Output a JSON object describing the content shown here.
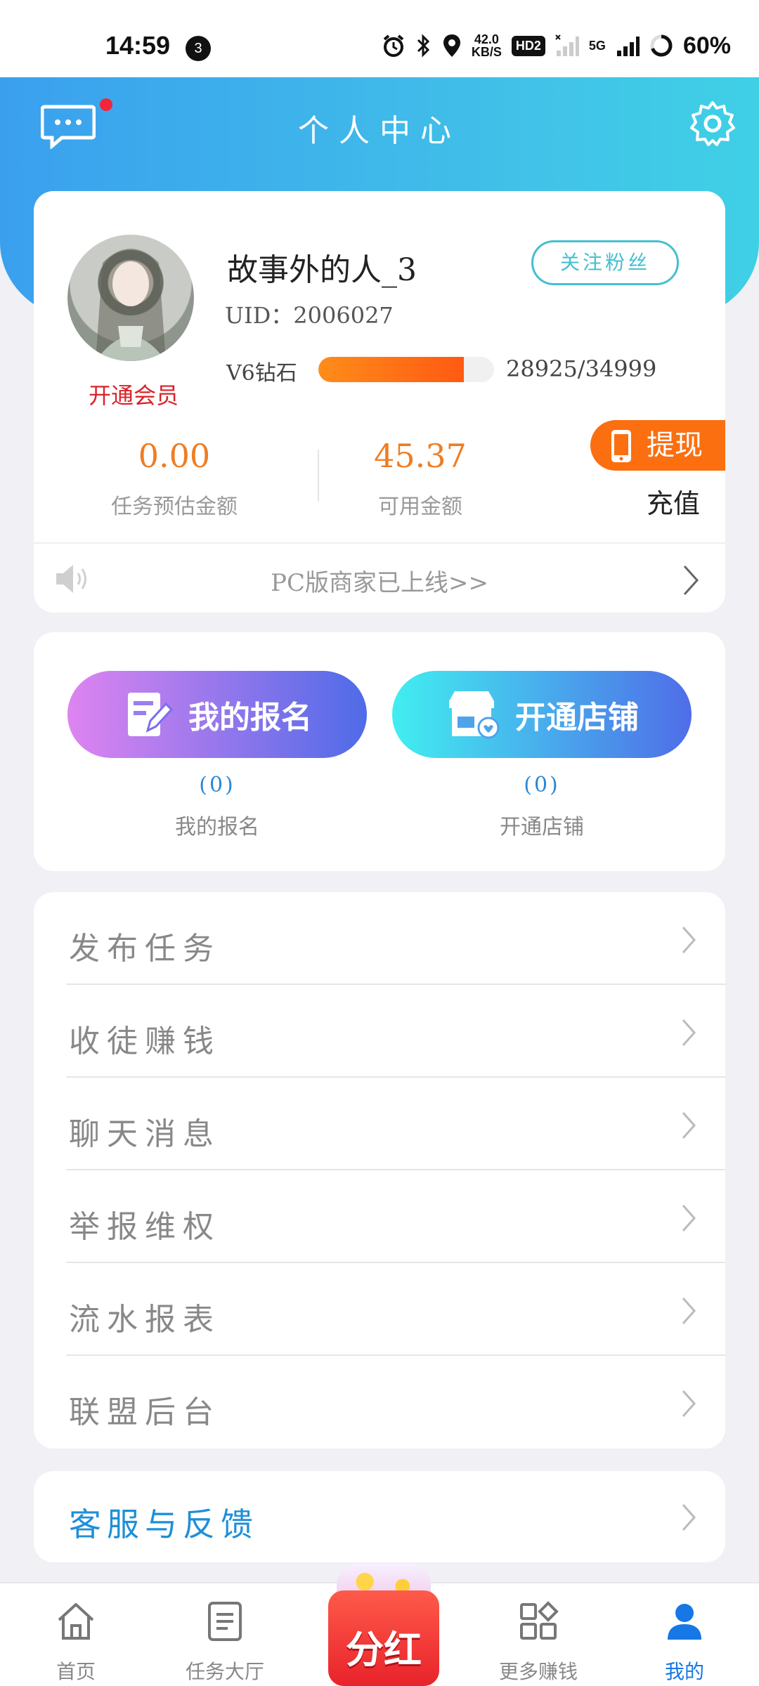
{
  "status_bar": {
    "time": "14:59",
    "notification_count": "3",
    "net_speed_value": "42.0",
    "net_speed_unit": "KB/S",
    "hd_badge": "HD2",
    "signal_label": "5G",
    "battery": "60%"
  },
  "header": {
    "title": "个人中心"
  },
  "profile": {
    "nickname": "故事外的人_3",
    "uid": "UID：2006027",
    "follow_button": "关注粉丝",
    "vip_link": "开通会员",
    "level_label": "V6钻石",
    "level_current": 28925,
    "level_max": 34999,
    "level_text": "28925/34999"
  },
  "wallet": {
    "estimated_amount": "0.00",
    "estimated_label": "任务预估金额",
    "available_amount": "45.37",
    "available_label": "可用金额",
    "withdraw_button": "提现",
    "recharge_link": "充值"
  },
  "notice": {
    "text": "PC版商家已上线>>"
  },
  "services": {
    "signup_button": "我的报名",
    "signup_count": "(0)",
    "signup_label": "我的报名",
    "shop_button": "开通店铺",
    "shop_count": "(0)",
    "shop_label": "开通店铺"
  },
  "menu": {
    "items": [
      {
        "label": "发布任务"
      },
      {
        "label": "收徒赚钱"
      },
      {
        "label": "聊天消息"
      },
      {
        "label": "举报维权"
      },
      {
        "label": "流水报表"
      },
      {
        "label": "联盟后台"
      }
    ]
  },
  "feedback": {
    "label": "客服与反馈"
  },
  "tabbar": {
    "home": "首页",
    "tasks": "任务大厅",
    "bonus": "分红",
    "more": "更多赚钱",
    "mine": "我的"
  },
  "colors": {
    "header_gradient_start": "#3aa0ee",
    "header_gradient_end": "#3fd0e6",
    "accent_orange": "#ef7d23",
    "active_tab": "#1677e6"
  }
}
